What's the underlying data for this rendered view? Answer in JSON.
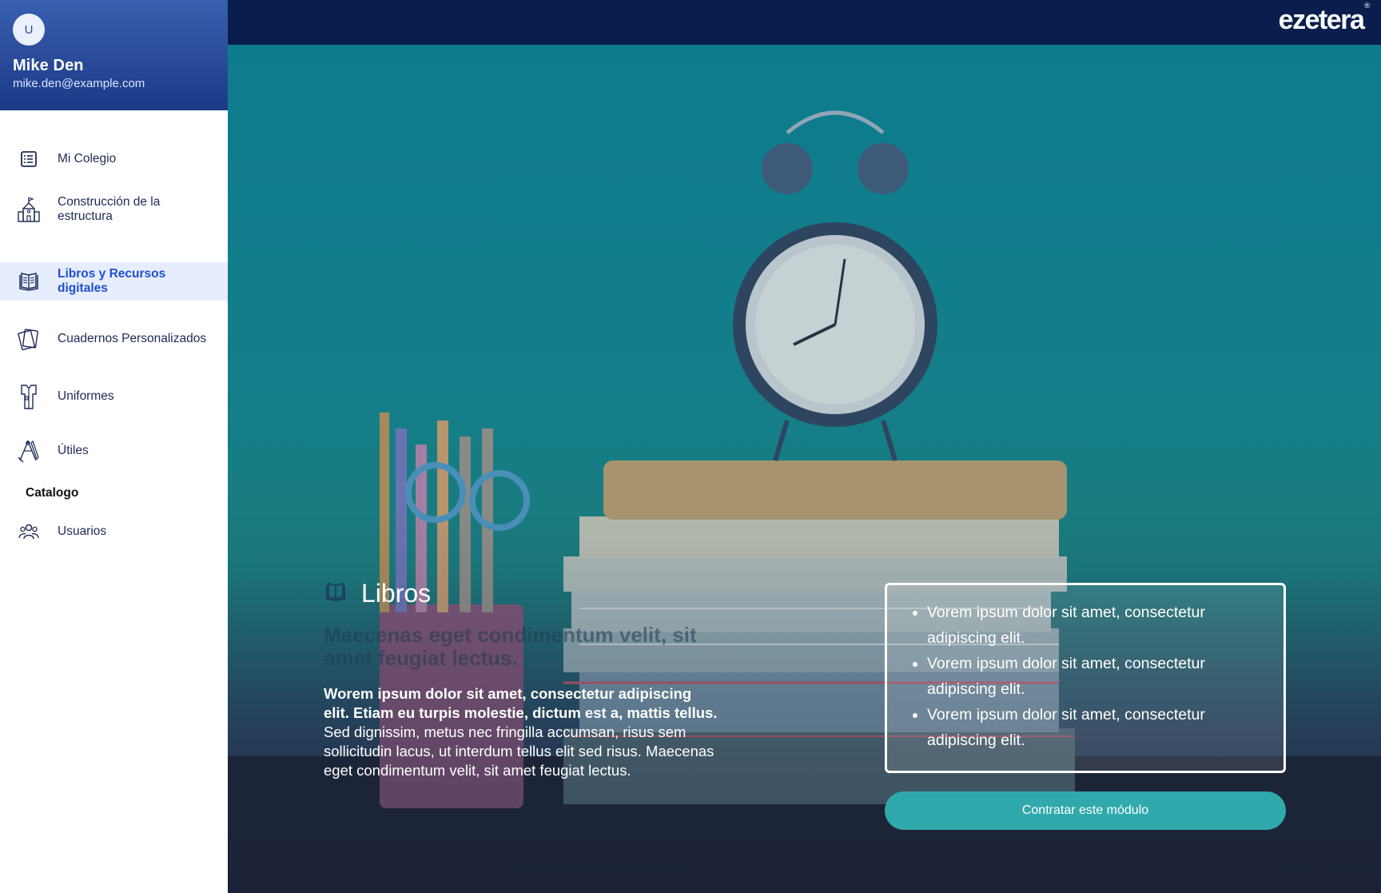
{
  "profile": {
    "avatar_initial": "U",
    "name": "Mike Den",
    "email": "mike.den@example.com"
  },
  "nav": {
    "items": [
      {
        "label": "Mi Colegio",
        "icon": "list-icon"
      },
      {
        "label": "Construcción de la estructura",
        "icon": "school-building-icon"
      },
      {
        "label": "Libros y Recursos digitales",
        "icon": "open-book-icon",
        "active": true
      },
      {
        "label": " Cuadernos Personalizados",
        "icon": "notebooks-icon"
      },
      {
        "label": "Uniformes",
        "icon": "uniform-icon"
      },
      {
        "label": "Útiles",
        "icon": "school-supplies-icon"
      }
    ],
    "section_label": "Catalogo",
    "users_label": "Usuarios"
  },
  "brand": {
    "name": "ezetera",
    "mark": "®"
  },
  "hero": {
    "title": "Libros",
    "faded_text": "Maecenas eget condimentum velit, sit amet feugiat lectus.",
    "para_bold": "Worem ipsum dolor sit amet, consectetur adipiscing elit. Etiam eu turpis molestie, dictum est a, mattis tellus.",
    "para_rest": " Sed dignissim, metus nec fringilla accumsan, risus sem sollicitudin lacus, ut interdum tellus elit sed risus. Maecenas eget condimentum velit, sit amet feugiat lectus.",
    "bullets": [
      "Vorem ipsum dolor sit amet, consectetur adipiscing elit.",
      "Vorem ipsum dolor sit amet, consectetur adipiscing elit.",
      "Vorem ipsum dolor sit amet, consectetur adipiscing elit."
    ],
    "cta": "Contratar este módulo"
  },
  "colors": {
    "sidebar_header": "#1b3a86",
    "topbar": "#0a1e4d",
    "active_bg": "#e6edff",
    "active_text": "#1f4fd1",
    "cta": "#2fa9ab"
  }
}
